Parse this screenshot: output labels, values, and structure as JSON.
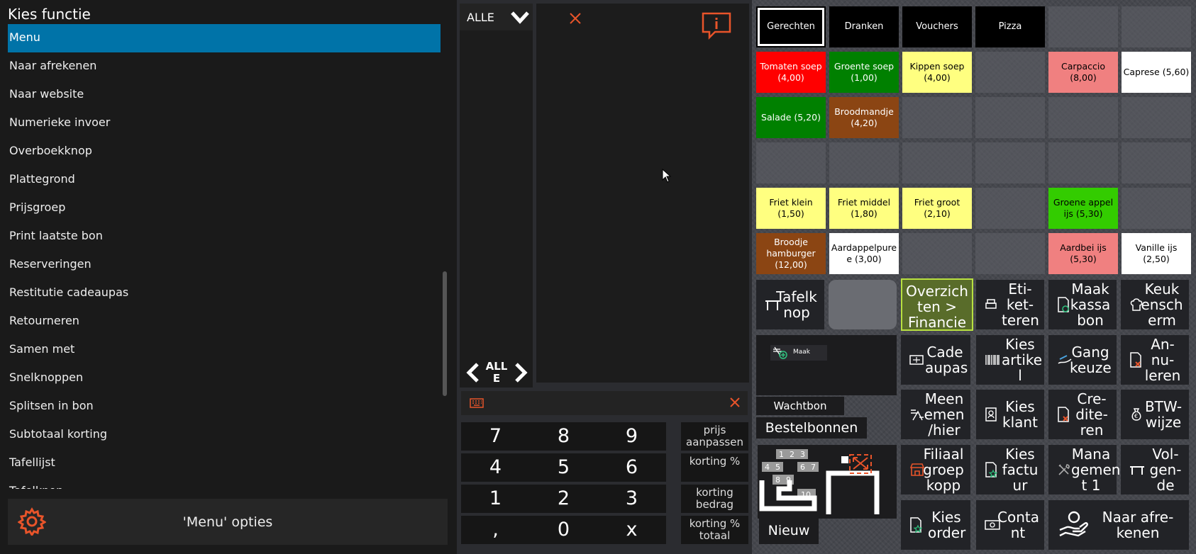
{
  "left_panel": {
    "title": "Kies functie",
    "items": [
      {
        "label": "Menu",
        "selected": true
      },
      {
        "label": "Naar afrekenen"
      },
      {
        "label": "Naar website"
      },
      {
        "label": "Numerieke invoer"
      },
      {
        "label": "Overboekknop"
      },
      {
        "label": "Plattegrond"
      },
      {
        "label": "Prijsgroep"
      },
      {
        "label": "Print laatste bon"
      },
      {
        "label": "Reserveringen"
      },
      {
        "label": "Restitutie cadeaupas"
      },
      {
        "label": "Retourneren"
      },
      {
        "label": "Samen met"
      },
      {
        "label": "Snelknoppen"
      },
      {
        "label": "Splitsen in bon"
      },
      {
        "label": "Subtotaal korting"
      },
      {
        "label": "Tafellijst"
      },
      {
        "label": "Tafelknop"
      }
    ],
    "options_label": "'Menu' opties",
    "options_icon": "gear-icon",
    "accent_color": "#0073a8",
    "icon_color": "#e8542a"
  },
  "order": {
    "category_header": "ALLE",
    "pager_label": "ALL E"
  },
  "keypad": {
    "keys": [
      "7",
      "8",
      "9",
      "4",
      "5",
      "6",
      "1",
      "2",
      "3",
      ",",
      "0",
      "x"
    ],
    "side_keys": [
      "prijs aanpassen",
      "korting %",
      "korting bedrag",
      "korting % totaal"
    ]
  },
  "categories": [
    "Gerechten",
    "Dranken",
    "Vouchers",
    "Pizza"
  ],
  "products": [
    {
      "label": "Tomaten soep (4,00)",
      "bg": "#ff0000",
      "fg": "#ffffff"
    },
    {
      "label": "Groente soep (1,00)",
      "bg": "#008000",
      "fg": "#ffffff"
    },
    {
      "label": "Kippen soep (4,00)",
      "bg": "#ffff80",
      "fg": "#000000"
    },
    {
      "label": "Carpaccio (8,00)",
      "bg": "#f08080",
      "fg": "#000000"
    },
    {
      "label": "Caprese (5,60)",
      "bg": "#ffffff",
      "fg": "#000000"
    },
    {
      "label": "Salade (5,20)",
      "bg": "#008000",
      "fg": "#ffffff"
    },
    {
      "label": "Broodmandje (4,20)",
      "bg": "#8b4513",
      "fg": "#ffffff"
    },
    {
      "label": "Friet klein (1,50)",
      "bg": "#ffff80",
      "fg": "#000000"
    },
    {
      "label": "Friet middel (1,80)",
      "bg": "#ffff80",
      "fg": "#000000"
    },
    {
      "label": "Friet groot (2,10)",
      "bg": "#ffff80",
      "fg": "#000000"
    },
    {
      "label": "Groene appel ijs (5,30)",
      "bg": "#33cc00",
      "fg": "#000000"
    },
    {
      "label": "Broodje hamburger (12,00)",
      "bg": "#8b4513",
      "fg": "#ffffff"
    },
    {
      "label": "Aardappelpure e (3,00)",
      "bg": "#ffffff",
      "fg": "#000000"
    },
    {
      "label": "Aardbei ijs (5,30)",
      "bg": "#f08080",
      "fg": "#000000"
    },
    {
      "label": "Vanille ijs (2,50)",
      "bg": "#ffffff",
      "fg": "#000000"
    }
  ],
  "functions": {
    "tafelknop": "Tafelk nop",
    "overzichten": "Overzich ten > Financie",
    "etiketten": "Eti- ket- teren",
    "maak_kassabon": "Maak kassa bon",
    "keukenscherm": "Keuk ensch erm",
    "cadeaupas": "Cade aupas",
    "kies_artikel": "Kies artike l",
    "gang_keuze": "Gang keuze",
    "annuleren": "An- nu- leren",
    "meenemen": "Meen emen /hier",
    "kies_klant": "Kies klant",
    "crediteren": "Cre- dite- ren",
    "btw_wijze": "BTW- wijze",
    "filiaal": "Filiaal groep kopp",
    "kies_factuur": "Kies factu ur",
    "management": "Mana gemen t 1",
    "volgende": "Vol- gen- de",
    "kies_order": "Kies order",
    "contant": "Conta nt",
    "naar_afrekenen": "Naar afre- kenen",
    "wachtbon": "Wachtbon",
    "wachtbon_mini": "Maak",
    "bestelbonnen": "Bestelbonnen",
    "nieuw": "Nieuw",
    "table_numbers": [
      "1",
      "2",
      "3",
      "4",
      "5",
      "6",
      "7",
      "8",
      "9",
      "10"
    ],
    "overzichten_color": "#b8e040"
  }
}
